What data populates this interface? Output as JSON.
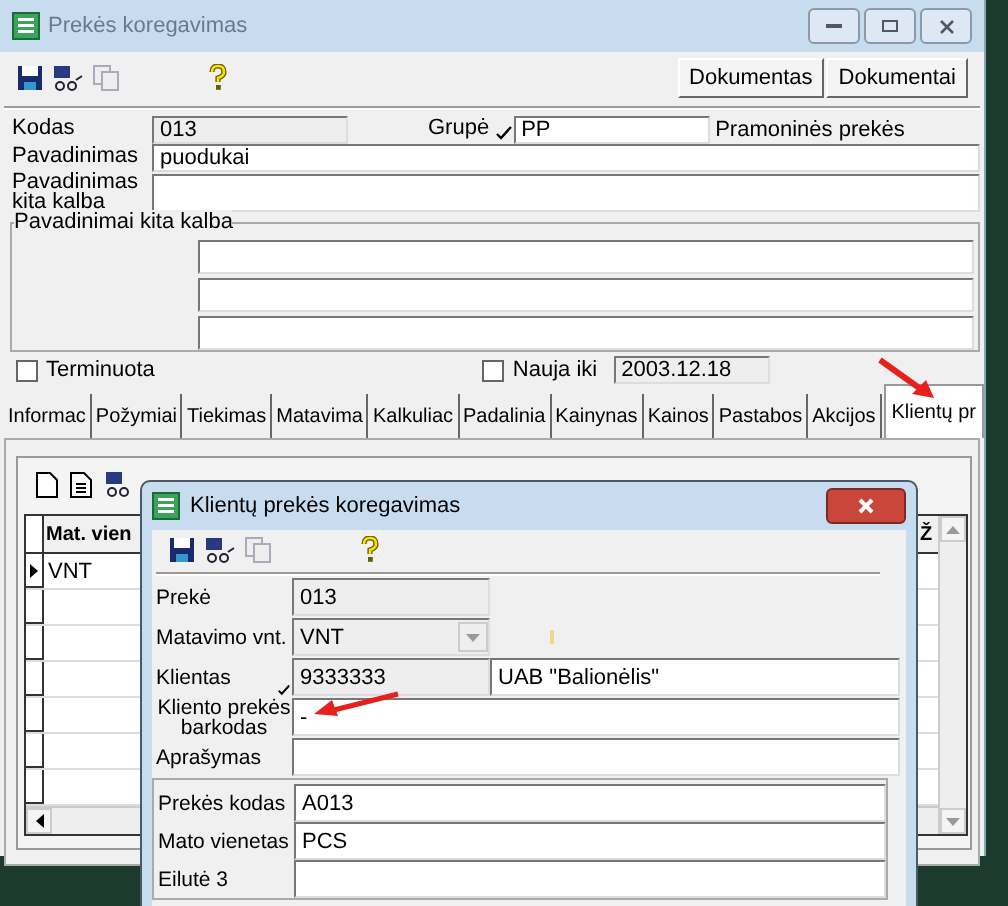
{
  "window": {
    "title": "Prekės koregavimas"
  },
  "toolbar": {
    "buttons": [
      "Dokumentas",
      "Dokumentai"
    ]
  },
  "form": {
    "kodas": {
      "label": "Kodas",
      "value": "013"
    },
    "grupe": {
      "label": "Grupė",
      "value": "PP",
      "description": "Pramoninės prekės"
    },
    "pavadinimas": {
      "label": "Pavadinimas",
      "value": "puodukai"
    },
    "pavadinimas_kita": {
      "label": "Pavadinimas kita kalba"
    },
    "group": {
      "title": "Pavadinimai kita kalba"
    },
    "terminuota": {
      "label": "Terminuota",
      "checked": false
    },
    "nauja_iki": {
      "label": "Nauja iki",
      "checked": false,
      "value": "2003.12.18"
    }
  },
  "tabs": [
    {
      "label": "Informac",
      "selected": false
    },
    {
      "label": "Požymiai",
      "selected": false
    },
    {
      "label": "Tiekimas",
      "selected": false
    },
    {
      "label": "Matavima",
      "selected": false
    },
    {
      "label": "Kalkuliac",
      "selected": false
    },
    {
      "label": "Padalinia",
      "selected": false
    },
    {
      "label": "Kainynas",
      "selected": false
    },
    {
      "label": "Kainos",
      "selected": false
    },
    {
      "label": "Pastabos",
      "selected": false
    },
    {
      "label": "Akcijos",
      "selected": false
    },
    {
      "label": "Klientų pr",
      "selected": true
    }
  ],
  "grid": {
    "columns": [
      "Mat. vien",
      "Ž"
    ],
    "rows": [
      [
        "VNT"
      ]
    ]
  },
  "dialog": {
    "title": "Klientų prekės koregavimas",
    "fields": [
      {
        "kind": "readonly",
        "label": "Prekė",
        "value": "013"
      },
      {
        "kind": "dropdown",
        "label": "Matavimo vnt.",
        "value": "VNT"
      },
      {
        "kind": "lookup",
        "label": "Klientas",
        "value": "9333333",
        "description": "UAB \"Balionėlis\""
      },
      {
        "kind": "text",
        "label": "Kliento prekės barkodas",
        "value": "-"
      },
      {
        "kind": "text",
        "label": "Aprašymas"
      }
    ],
    "group_fields": [
      {
        "label": "Prekės kodas",
        "value": "A013"
      },
      {
        "label": "Mato vienetas",
        "value": "PCS"
      },
      {
        "label": "Eilutė 3"
      }
    ]
  }
}
